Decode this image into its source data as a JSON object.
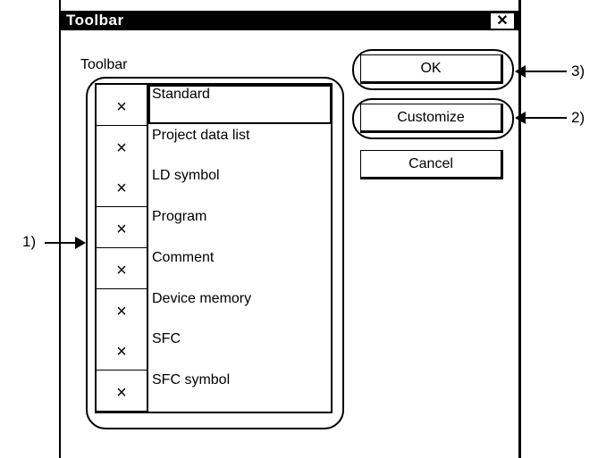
{
  "window": {
    "title": "Toolbar",
    "close_glyph": "✕"
  },
  "group_label": "Toolbar",
  "toolbar_items": [
    {
      "label": "Standard",
      "mark": "×",
      "selected": true
    },
    {
      "label": "Project data list",
      "mark": "×"
    },
    {
      "label": "LD symbol",
      "mark": "×"
    },
    {
      "label": "Program",
      "mark": "×"
    },
    {
      "label": "Comment",
      "mark": "×"
    },
    {
      "label": "Device memory",
      "mark": "×"
    },
    {
      "label": "SFC",
      "mark": "×"
    },
    {
      "label": "SFC symbol",
      "mark": "×"
    }
  ],
  "buttons": {
    "ok": "OK",
    "customize": "Customize",
    "cancel": "Cancel"
  },
  "callouts": {
    "list": "1)",
    "customize": "2)",
    "ok": "3)"
  }
}
